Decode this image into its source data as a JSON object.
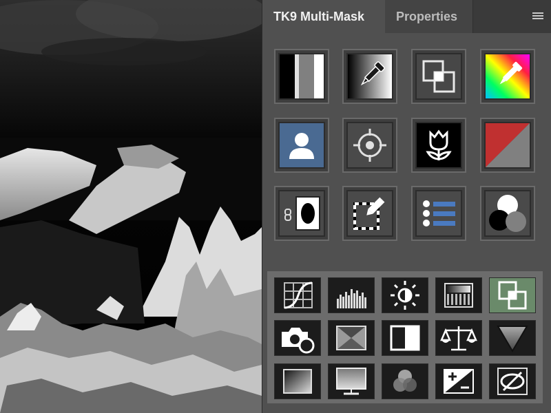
{
  "tabs": [
    {
      "label": "TK9 Multi-Mask",
      "active": true
    },
    {
      "label": "Properties",
      "active": false
    }
  ],
  "menu_icon": "hamburger-menu-icon",
  "big_tools": [
    {
      "icon": "grayscale-bars-icon"
    },
    {
      "icon": "gradient-eyedropper-icon"
    },
    {
      "icon": "overlapping-squares-icon"
    },
    {
      "icon": "color-spectrum-eyedropper-icon"
    },
    {
      "icon": "person-icon"
    },
    {
      "icon": "crosshair-target-icon"
    },
    {
      "icon": "tulip-icon"
    },
    {
      "icon": "red-gray-split-icon"
    },
    {
      "icon": "linked-mask-icon"
    },
    {
      "icon": "selection-pencil-icon"
    },
    {
      "icon": "list-icon"
    },
    {
      "icon": "overlapping-circles-icon"
    }
  ],
  "small_tools": [
    {
      "icon": "curves-icon"
    },
    {
      "icon": "histogram-levels-icon"
    },
    {
      "icon": "brightness-icon"
    },
    {
      "icon": "gradient-map-icon"
    },
    {
      "icon": "overlapping-squares-icon"
    },
    {
      "icon": "camera-icon"
    },
    {
      "icon": "envelope-icon"
    },
    {
      "icon": "half-square-icon"
    },
    {
      "icon": "balance-scale-icon"
    },
    {
      "icon": "triangle-gradient-icon"
    },
    {
      "icon": "gradient-square-icon"
    },
    {
      "icon": "monitor-icon"
    },
    {
      "icon": "rgb-circles-icon"
    },
    {
      "icon": "plus-minus-icon"
    },
    {
      "icon": "eye-crossed-icon"
    }
  ],
  "colors": {
    "panel": "#505050",
    "tabbar": "#3a3a3a",
    "accent_blue": "#4a6a92",
    "accent_green": "#6a8a6a",
    "red": "#c03030"
  }
}
